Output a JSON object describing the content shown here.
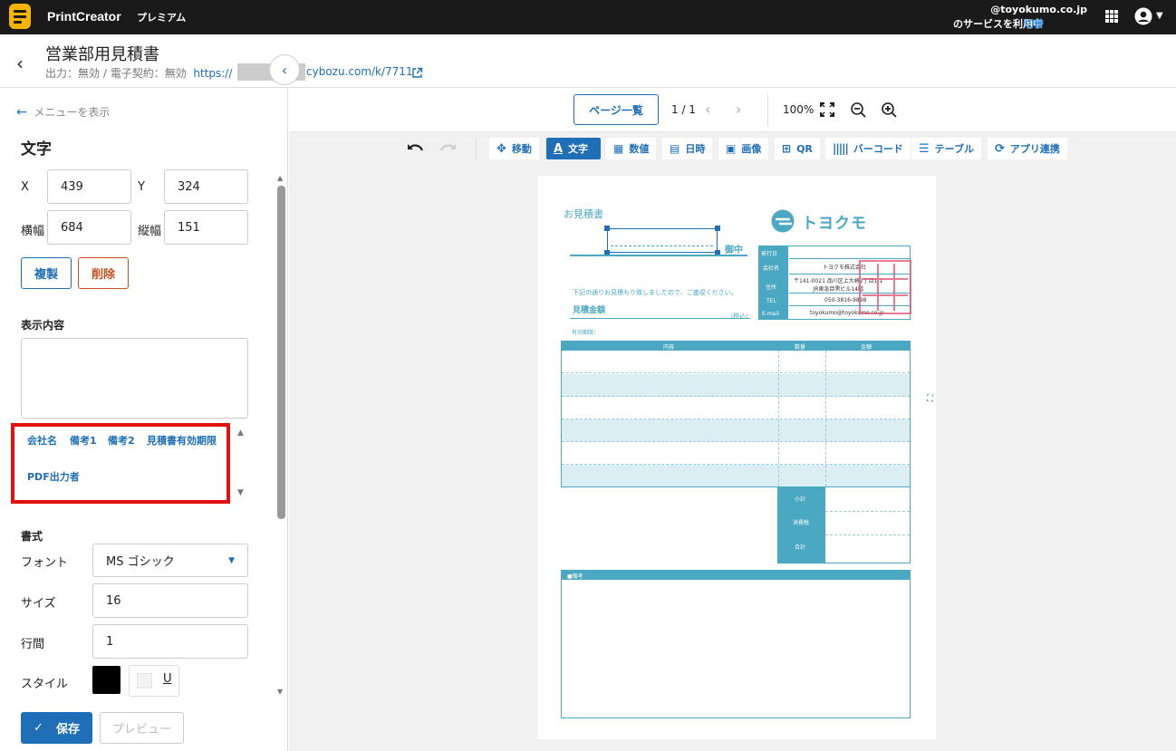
{
  "topbar": {
    "app_name": "PrintCreator",
    "plan": "プレミアム",
    "account_line1": "@toyokumo.co.jp",
    "account_line2": "のサービスを利用中",
    "switch": "切替"
  },
  "header": {
    "title": "営業部用見積書",
    "output_label": "出力：",
    "output_value": "無効",
    "sep": " / ",
    "contract_label": "電子契約：",
    "contract_value": "無効",
    "url_part1": "https://",
    "url_part2": "cybozu.com/k/7711"
  },
  "panel": {
    "menu_link": "メニューを表示",
    "section_title": "文字",
    "x_label": "X",
    "x_value": "439",
    "y_label": "Y",
    "y_value": "324",
    "w_label": "横幅",
    "w_value": "684",
    "h_label": "縦幅",
    "h_value": "151",
    "duplicate": "複製",
    "delete": "削除",
    "content_label": "表示内容",
    "content_value": "",
    "fields": [
      "会社名",
      "備考1",
      "備考2",
      "見積書有効期限",
      "PDF出力者"
    ],
    "format_label": "書式",
    "font_label": "フォント",
    "font_value": "MS ゴシック",
    "size_label": "サイズ",
    "size_value": "16",
    "line_label": "行間",
    "line_value": "1",
    "style_label": "スタイル",
    "underline": "U",
    "save": "保存",
    "preview": "プレビュー"
  },
  "viewer": {
    "pages_button": "ページ一覧",
    "page_indicator": "1 / 1",
    "zoom": "100%",
    "tools": [
      "移動",
      "文字",
      "数値",
      "日時",
      "画像",
      "QR",
      "バーコード",
      "テーブル",
      "アプリ連携"
    ]
  },
  "doc": {
    "title": "お見積書",
    "company_logo": "トヨクモ",
    "honorific": "御中",
    "intro": "下記の通りお見積もり致しましたので、ご査収ください。",
    "amount_label": "見積金額",
    "tax_note": "（税込）",
    "valid_label": "有効期限：",
    "info_labels": [
      "発行日",
      "会社名",
      "住所",
      "TEL",
      "E-mail"
    ],
    "info_values": [
      "",
      "トヨクモ株式会社",
      "〒141-0021 品川区上大崎2丁目1-1\nJR東急目黒ビル14階",
      "050-3816-9898",
      "toyokumo@toyokumo.co.jp"
    ],
    "table_headers": [
      "内容",
      "数量",
      "金額"
    ],
    "totals": [
      "小計",
      "消費税",
      "合計"
    ],
    "notes_label": "■備考"
  },
  "colors": {
    "accent": "#1f6fb8",
    "teal": "#4aa8c3",
    "danger": "#c8501e",
    "highlight": "#e01010",
    "stamp": "#e05070"
  }
}
